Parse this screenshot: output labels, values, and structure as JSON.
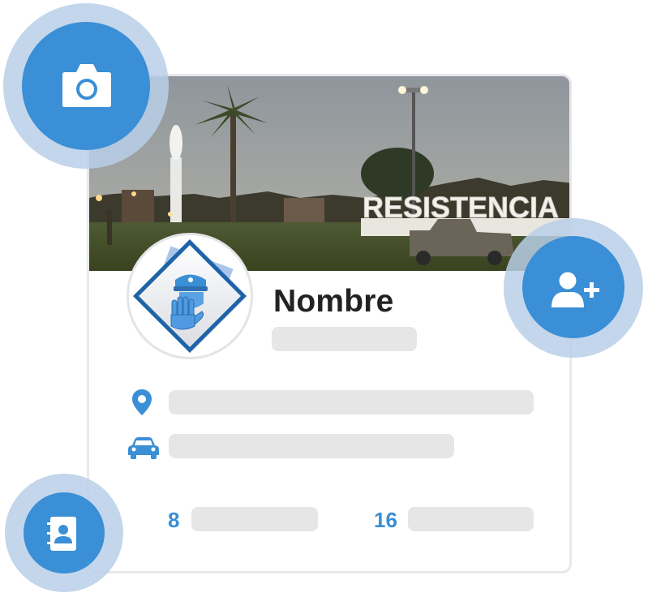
{
  "profile": {
    "name": "Nombre",
    "cover_sign_text": "RESISTENCIA",
    "stats": [
      {
        "value": "8"
      },
      {
        "value": "16"
      }
    ]
  },
  "colors": {
    "accent": "#3a8fd6",
    "halo": "#b9cfe8",
    "placeholder": "#e6e6e6",
    "card_border": "#e8e8ec",
    "name_text": "#222222"
  },
  "icons": {
    "camera": "camera-icon",
    "add_user": "add-user-icon",
    "contacts": "contact-book-icon",
    "location": "location-pin-icon",
    "vehicle": "car-icon",
    "avatar": "police-stop-hand-icon"
  }
}
